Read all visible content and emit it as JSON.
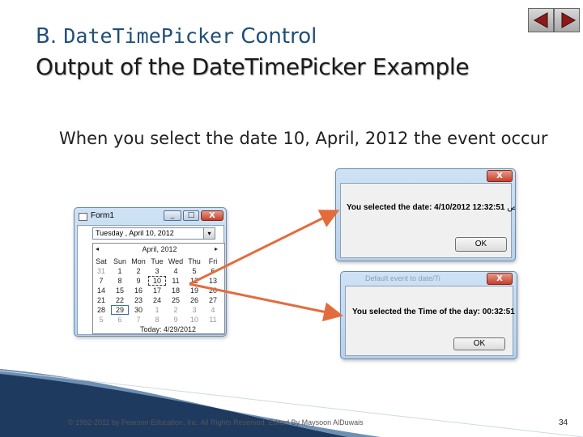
{
  "slide": {
    "title_prefix": "B.",
    "title_code": "DateTimePicker",
    "title_suffix": "Control",
    "subtitle": "Output of the DateTimePicker Example",
    "bullet_mark": "",
    "bullet_text": "When you select the date 10, April, 2012 the event occur",
    "footer": "© 1992-2011 by Pearson Education, Inc. All Rights Reserved. Edited By Maysoon AlDuwais",
    "page_number": "34"
  },
  "nav": {
    "prev_icon": "triangle-left-icon",
    "next_icon": "triangle-right-icon"
  },
  "form1": {
    "title": "Form1",
    "minimize": "_",
    "maximize": "□",
    "close": "X",
    "picker_value": "Tuesday ,    April    10, 2012",
    "picker_drop": "▾",
    "calendar": {
      "month_label": "April, 2012",
      "prev_arrow": "◂",
      "next_arrow": "▸",
      "day_names": [
        "Sat",
        "Sun",
        "Mon",
        "Tue",
        "Wed",
        "Thu",
        "Fri"
      ],
      "weeks": [
        [
          "31",
          "1",
          "2",
          "3",
          "4",
          "5",
          "6"
        ],
        [
          "7",
          "8",
          "9",
          "10",
          "11",
          "12",
          "13"
        ],
        [
          "14",
          "15",
          "16",
          "17",
          "18",
          "19",
          "20"
        ],
        [
          "21",
          "22",
          "23",
          "24",
          "25",
          "26",
          "27"
        ],
        [
          "28",
          "29",
          "30",
          "1",
          "2",
          "3",
          "4"
        ],
        [
          "5",
          "6",
          "7",
          "8",
          "9",
          "10",
          "11"
        ]
      ],
      "today_label": "Today: 4/29/2012"
    }
  },
  "msgbox_date": {
    "close": "X",
    "message": "You selected the date: 4/10/2012 12:32:51",
    "message_trail": "ص",
    "ok": "OK"
  },
  "msgbox_time": {
    "title": "Default event to date/Ti",
    "close": "X",
    "message": "You selected the Time of the day: 00:32:51",
    "ok": "OK"
  },
  "colors": {
    "title_blue": "#1f4e79",
    "arrow_orange": "#e36c3c",
    "footer_band": "#1f3a5f"
  }
}
